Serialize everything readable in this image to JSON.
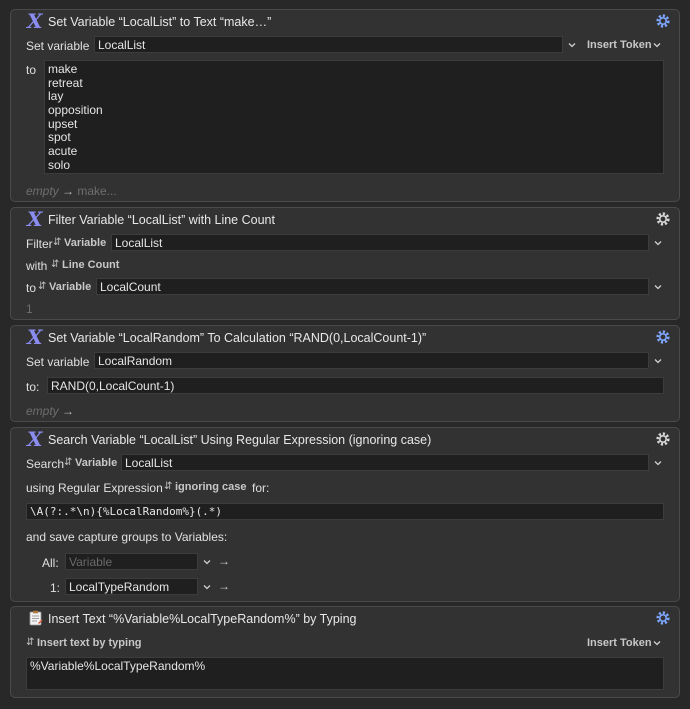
{
  "actions": [
    {
      "title": "Set Variable “LocalList” to Text “make…”",
      "set_variable_label": "Set variable",
      "variable": "LocalList",
      "insert_token": "Insert Token",
      "to_label": "to",
      "text_lines": [
        "make",
        "retreat",
        "lay",
        "opposition",
        "upset",
        "spot",
        "acute",
        "solo"
      ],
      "summary_empty": "empty",
      "summary_value": "make..."
    },
    {
      "title": "Filter Variable “LocalList” with Line Count",
      "filter_label": "Filter",
      "source_type": "Variable",
      "source_variable": "LocalList",
      "with_label": "with",
      "filter_type": "Line Count",
      "to_label": "to",
      "dest_type": "Variable",
      "dest_variable": "LocalCount",
      "result_preview": "1"
    },
    {
      "title": "Set Variable “LocalRandom” To Calculation “RAND(0,LocalCount-1)”",
      "set_variable_label": "Set variable",
      "variable": "LocalRandom",
      "to_label": "to:",
      "calculation": "RAND(0,LocalCount-1)",
      "summary_empty": "empty"
    },
    {
      "title": "Search Variable “LocalList” Using Regular Expression (ignoring case)",
      "search_label": "Search",
      "source_type": "Variable",
      "source_variable": "LocalList",
      "using_label": "using Regular Expression",
      "case_option": "ignoring case",
      "for_label": "for:",
      "regex": "\\A(?:.*\\n){%LocalRandom%}(.*)",
      "save_label": "and save capture groups to Variables:",
      "all_label": "All:",
      "all_placeholder": "Variable",
      "group1_label": "1:",
      "group1_variable": "LocalTypeRandom"
    },
    {
      "title": "Insert Text “%Variable%LocalTypeRandom%” by Typing",
      "mode": "Insert text by typing",
      "insert_token": "Insert Token",
      "text": "%Variable%LocalTypeRandom%"
    }
  ],
  "colors": {
    "window_bg": "#282828",
    "action_bg": "#323232",
    "field_bg": "#1f1f1f",
    "accent_x_icon": "#8a8cf0",
    "gear_icon": "#7ea6ff"
  },
  "icons": {
    "execute_action": "x-script-icon",
    "options": "gear-icon",
    "insert_text": "clipboard-document-icon"
  }
}
